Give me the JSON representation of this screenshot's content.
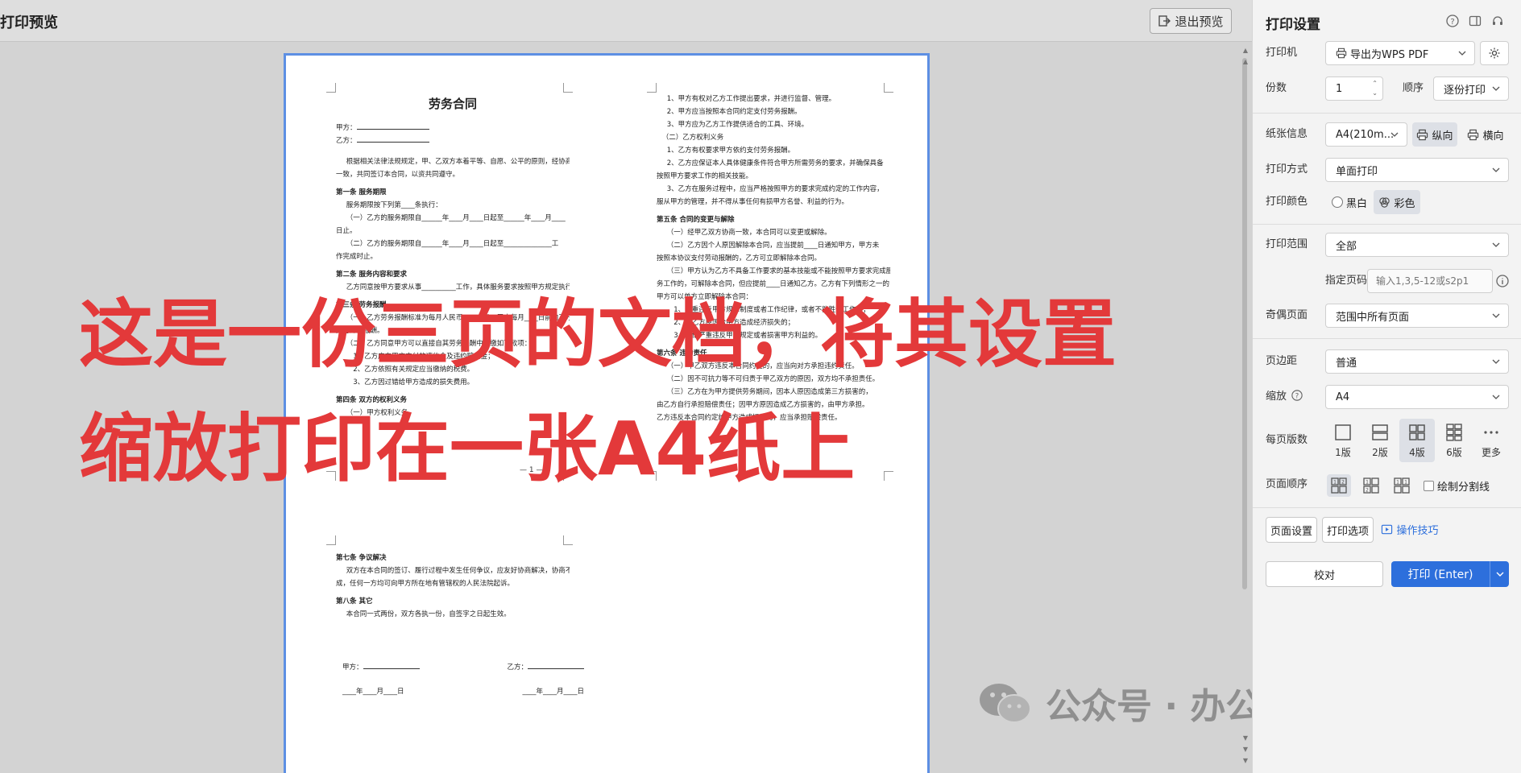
{
  "preview": {
    "title": "打印预览",
    "exit_button": "退出预览",
    "page_number": "— 1 —"
  },
  "document": {
    "title": "劳务合同",
    "party_a": "甲方：",
    "party_b": "乙方：",
    "page1_lines": [
      "根据相关法律法规规定，甲、乙双方本着平等、自愿、公平的原则，经协商",
      "一致，共同签订本合同，以资共同遵守。",
      "第一条 服务期限",
      "服务期限按下列第____条执行：",
      "（一）乙方的服务期限自______年____月____日起至______年____月____",
      "日止。",
      "（二）乙方的服务期限自______年____月____日起至______________工",
      "作完成时止。",
      "第二条 服务内容和要求",
      "乙方同意按甲方要求从事__________工作，具体服务要求按照甲方规定执行。",
      "第三条 劳务报酬",
      "（一）乙方劳务报酬标准为每月人民币______元，甲方每月____日前向乙方",
      "支付劳务报酬。",
      "（二）乙方同意甲方可以直接自其劳务报酬中扣缴如下款项：",
      "1、乙方应向甲方支付的违约金及违约赔偿金；",
      "2、乙方依照有关规定应当缴纳的税费。",
      "3、乙方因过错给甲方造成的损失费用。",
      "第四条 双方的权利义务",
      "（一）甲方权利义务"
    ],
    "page2_lines": [
      "1、甲方有权对乙方工作提出要求，并进行监督、管理。",
      "2、甲方应当按照本合同约定支付劳务报酬。",
      "3、甲方应为乙方工作提供适合的工具、环境。",
      "（二）乙方权利义务",
      "1、乙方有权要求甲方依约支付劳务报酬。",
      "2、乙方应保证本人具体健康条件符合甲方所需劳务的要求，并确保具备",
      "按照甲方要求工作的相关技能。",
      "3、乙方在服务过程中，应当严格按照甲方的要求完成约定的工作内容，",
      "服从甲方的管理，并不得从事任何有损甲方名誉、利益的行为。",
      "第五条 合同的变更与解除",
      "（一）经甲乙双方协商一致，本合同可以变更或解除。",
      "（二）乙方因个人原因解除本合同，应当提前____日通知甲方，甲方未",
      "按照本协议支付劳动报酬的，乙方可立即解除本合同。",
      "（三）甲方认为乙方不具备工作要求的基本技能或不能按照甲方要求完成服",
      "务工作的，可解除本合同，但应提前____日通知乙方。乙方有下列情形之一的，",
      "甲方可以单方立即解除本合同：",
      "1、严重违反甲方规章制度或者工作纪律，或者不能胜任工作的；",
      "2、因乙方原因给甲方造成经济损失的；",
      "3、其他严重违反甲方规定或者损害甲方利益的。",
      "第六条 违约责任",
      "（一）甲乙双方违反本合同约定的，应当向对方承担违约责任。",
      "（二）因不可抗力等不可归责于甲乙双方的原因，双方均不承担责任。",
      "（三）乙方在为甲方提供劳务期间，因本人原因造成第三方损害的，",
      "由乙方自行承担赔偿责任；因甲方原因造成乙方损害的，由甲方承担。",
      "乙方违反本合同约定给甲方造成损失的，应当承担赔偿责任。"
    ],
    "page3_lines": [
      "第七条 争议解决",
      "双方在本合同的签订、履行过程中发生任何争议，应友好协商解决，协商不",
      "成，任何一方均可向甲方所在地有管辖权的人民法院起诉。",
      "第八条 其它",
      "本合同一式两份，双方各执一份，自签字之日起生效。"
    ],
    "sign_a": "甲方：",
    "sign_b": "乙方：",
    "date_a": "____年____月____日",
    "date_b": "____年____月____日"
  },
  "overlay": {
    "line1": "这是一份三页的文档，将其设置",
    "line2": "缩放打印在一张A4纸上"
  },
  "watermark": {
    "text": "公众号 · 办公技能指南社"
  },
  "panel": {
    "title": "打印设置",
    "printer_label": "打印机",
    "printer_value": "导出为WPS PDF",
    "copies_label": "份数",
    "copies_value": "1",
    "order_label": "顺序",
    "order_value": "逐份打印",
    "paper_label": "纸张信息",
    "paper_value": "A4(210m...",
    "portrait_label": "纵向",
    "landscape_label": "横向",
    "mode_label": "打印方式",
    "mode_value": "单面打印",
    "color_label": "打印颜色",
    "bw_label": "黑白",
    "color_option_label": "彩色",
    "range_label": "打印范围",
    "range_value": "全部",
    "page_spec_label": "指定页码",
    "page_spec_placeholder": "输入1,3,5-12或s2p1",
    "odd_even_label": "奇偶页面",
    "odd_even_value": "范围中所有页面",
    "margin_label": "页边距",
    "margin_value": "普通",
    "zoom_label": "缩放",
    "zoom_value": "A4",
    "pps_label": "每页版数",
    "pps_options": [
      "1版",
      "2版",
      "4版",
      "6版",
      "更多"
    ],
    "page_order_label": "页面顺序",
    "draw_lines_label": "绘制分割线",
    "page_setup_button": "页面设置",
    "print_options_button": "打印选项",
    "tips_link": "操作技巧",
    "proof_button": "校对",
    "print_button": "打印 (Enter)"
  }
}
